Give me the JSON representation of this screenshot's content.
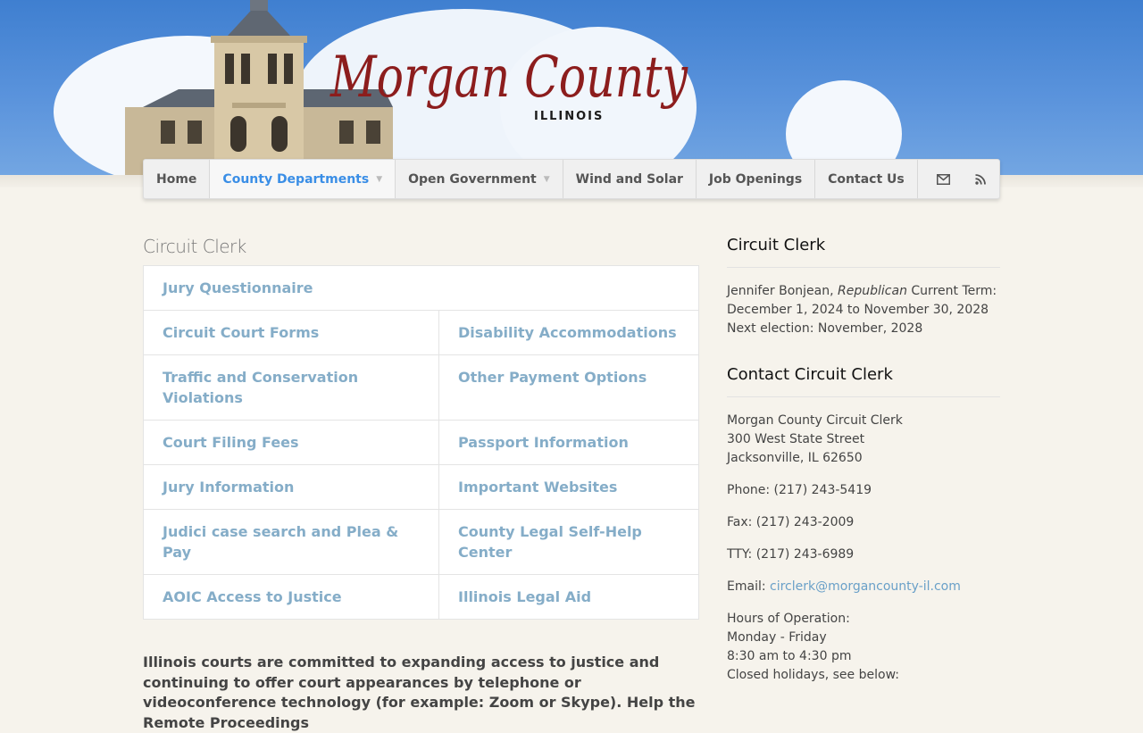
{
  "header": {
    "logo_text": "Morgan County",
    "logo_sub": "ILLINOIS"
  },
  "nav": {
    "home": "Home",
    "county_departments": "County Departments",
    "open_government": "Open Government",
    "wind_solar": "Wind and Solar",
    "job_openings": "Job Openings",
    "contact_us": "Contact Us",
    "icons": [
      "mail-icon",
      "rss-icon"
    ]
  },
  "main": {
    "title": "Circuit Clerk",
    "links": {
      "jury_questionnaire": "Jury Questionnaire",
      "circuit_court_forms": "Circuit Court Forms",
      "disability_accommodations": "Disability Accommodations",
      "traffic_conservation": "Traffic and Conservation Violations",
      "other_payment": "Other Payment Options",
      "court_filing_fees": "Court Filing Fees",
      "passport_information": "Passport Information",
      "jury_information": "Jury Information",
      "important_websites": "Important Websites",
      "judici": "Judici case search and Plea & Pay",
      "legal_self_help": "County Legal Self-Help Center",
      "aoic": "AOIC Access to Justice",
      "illinois_legal_aid": "Illinois Legal Aid"
    },
    "intro": "Illinois courts are committed to expanding access to justice and continuing to offer court appearances by telephone or videoconference technology (for example: Zoom or Skype). Help the Remote Proceedings"
  },
  "sidebar": {
    "clerk_heading": "Circuit Clerk",
    "clerk_name": "Jennifer Bonjean,",
    "clerk_party": "Republican",
    "clerk_term_label": "Current Term:",
    "clerk_term": "December 1, 2024 to November 30, 2028",
    "clerk_next": "Next election: November, 2028",
    "contact_heading": "Contact Circuit Clerk",
    "address_1": "Morgan County Circuit Clerk",
    "address_2": "300 West State Street",
    "address_3": "Jacksonville, IL 62650",
    "phone": "Phone: (217) 243-5419",
    "fax": "Fax: (217) 243-2009",
    "tty": "TTY: (217) 243-6989",
    "email_label": "Email:",
    "email": "circlerk@morgancounty-il.com",
    "hours_label": "Hours of Operation:",
    "hours_days": "Monday - Friday",
    "hours_time": "8:30 am to 4:30 pm",
    "hours_note": "Closed holidays, see below:"
  },
  "colors": {
    "link": "#85adc8",
    "nav_active": "#3a8ee6",
    "logo_red": "#8c1d1d"
  }
}
